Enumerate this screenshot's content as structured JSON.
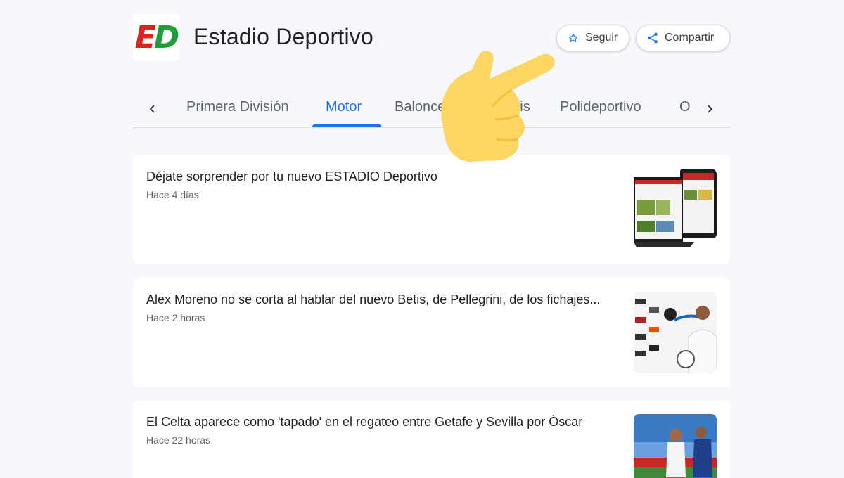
{
  "publication": {
    "logo_text_1": "E",
    "logo_text_2": "D",
    "title": "Estadio Deportivo"
  },
  "actions": {
    "follow_label": "Seguir",
    "share_label": "Compartir",
    "follow_icon": "star-icon",
    "share_icon": "share-icon"
  },
  "tabs": {
    "items": [
      {
        "label": "Primera División",
        "active": false
      },
      {
        "label": "Motor",
        "active": true
      },
      {
        "label": "Baloncesto",
        "active": false
      },
      {
        "label": "Tenis",
        "active": false
      },
      {
        "label": "Polideportivo",
        "active": false
      },
      {
        "label": "O",
        "active": false
      }
    ]
  },
  "articles": [
    {
      "title": "Déjate sorprender por tu nuevo ESTADIO Deportivo",
      "time": "Hace 4 días"
    },
    {
      "title": "Alex Moreno no se corta al hablar del nuevo Betis, de Pellegrini, de los fichajes...",
      "time": "Hace 2 horas"
    },
    {
      "title": "El Celta aparece como 'tapado' en el regateo entre Getafe y Sevilla por Óscar",
      "time": "Hace 22 horas"
    }
  ],
  "colors": {
    "background": "#f6f8fc",
    "accent": "#1a73e8",
    "logo_red": "#d9241f",
    "logo_green": "#1f9d3c",
    "hand_emoji": "#fdd663"
  }
}
